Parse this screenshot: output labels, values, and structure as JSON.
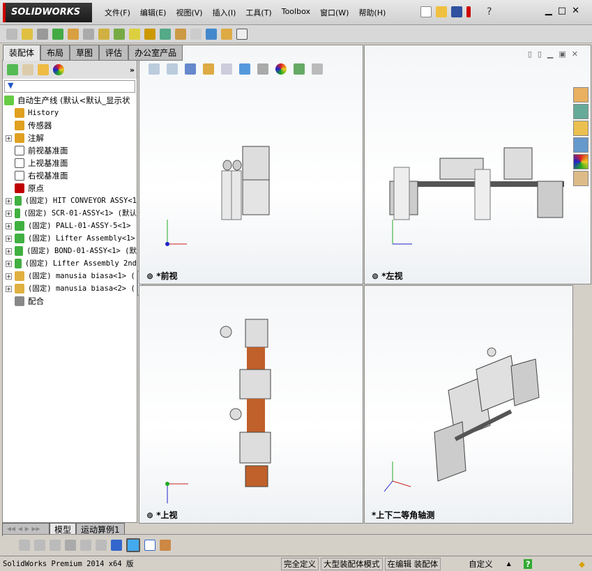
{
  "app": {
    "logo": "SOLIDWORKS"
  },
  "menu": [
    "文件(F)",
    "编辑(E)",
    "视图(V)",
    "插入(I)",
    "工具(T)",
    "Toolbox",
    "窗口(W)",
    "帮助(H)"
  ],
  "tabs": [
    "装配体",
    "布局",
    "草图",
    "评估",
    "办公室产品"
  ],
  "tree": {
    "root": "自动生产线  (默认<默认_显示状",
    "items": [
      {
        "label": "History",
        "mono": true,
        "expand": false,
        "color": "#e0a020"
      },
      {
        "label": "传感器",
        "expand": false,
        "color": "#e0a020"
      },
      {
        "label": "注解",
        "expand": true,
        "color": "#e0a020"
      },
      {
        "label": "前视基准面",
        "expand": false,
        "color": "#ffffff"
      },
      {
        "label": "上视基准面",
        "expand": false,
        "color": "#ffffff"
      },
      {
        "label": "右视基准面",
        "expand": false,
        "color": "#ffffff"
      },
      {
        "label": "原点",
        "expand": false,
        "color": "#c00000"
      },
      {
        "label": "(固定) HIT CONVEYOR ASSY<1",
        "mono": true,
        "expand": true,
        "color": "#40b040"
      },
      {
        "label": "(固定) SCR-01-ASSY<1> (默认",
        "mono": true,
        "expand": true,
        "color": "#40b040"
      },
      {
        "label": "(固定) PALL-01-ASSY-5<1>",
        "mono": true,
        "expand": true,
        "color": "#40b040"
      },
      {
        "label": "(固定) Lifter Assembly<1>",
        "mono": true,
        "expand": true,
        "color": "#40b040"
      },
      {
        "label": "(固定) BOND-01-ASSY<1> (默",
        "mono": true,
        "expand": true,
        "color": "#40b040"
      },
      {
        "label": "(固定) Lifter Assembly 2nd",
        "mono": true,
        "expand": true,
        "color": "#40b040"
      },
      {
        "label": "(固定) manusia biasa<1> (",
        "mono": true,
        "expand": true,
        "color": "#e0b040"
      },
      {
        "label": "(固定) manusia biasa<2> (",
        "mono": true,
        "expand": true,
        "color": "#e0b040"
      },
      {
        "label": "配合",
        "expand": false,
        "color": "#888888"
      }
    ]
  },
  "viewports": {
    "front": "*前视",
    "left": "*左视",
    "top": "*上视",
    "iso": "*上下二等角轴测"
  },
  "bottom_tabs": [
    "模型",
    "运动算例1"
  ],
  "status": {
    "product": "SolidWorks Premium 2014 x64 版",
    "fields": [
      "完全定义",
      "大型装配体模式",
      "在编辑 装配体"
    ],
    "custom": "自定义"
  }
}
